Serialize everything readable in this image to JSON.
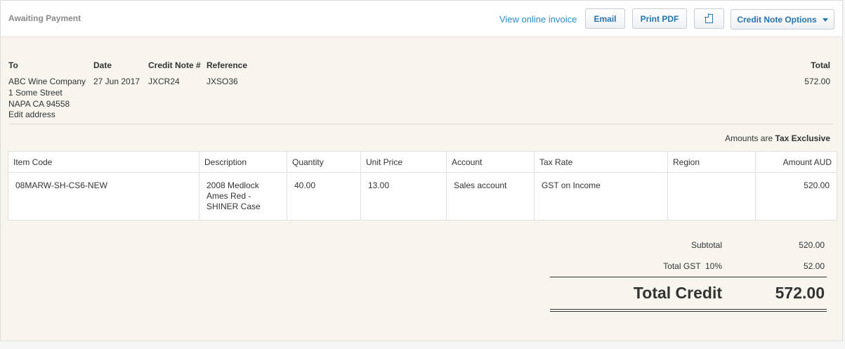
{
  "header": {
    "status": "Awaiting Payment",
    "view_online": "View online invoice",
    "email": "Email",
    "print_pdf": "Print PDF",
    "options": "Credit Note Options"
  },
  "info": {
    "to_label": "To",
    "date_label": "Date",
    "number_label": "Credit Note #",
    "reference_label": "Reference",
    "total_label": "Total",
    "contact": "ABC Wine Company",
    "address_line1": "1 Some Street",
    "address_line2": "NAPA CA 94558",
    "edit_address": "Edit address",
    "date": "27 Jun 2017",
    "number": "JXCR24",
    "reference": "JXSO36",
    "total": "572.00"
  },
  "amounts_are": {
    "prefix": "Amounts are",
    "value": "Tax Exclusive"
  },
  "table": {
    "headers": [
      "Item Code",
      "Description",
      "Quantity",
      "Unit Price",
      "Account",
      "Tax Rate",
      "Region",
      "Amount AUD"
    ],
    "rows": [
      {
        "item_code": "08MARW-SH-CS6-NEW",
        "description": "2008 Medlock Ames Red - SHINER Case",
        "quantity": "40.00",
        "unit_price": "13.00",
        "account": "Sales account",
        "tax_rate": "GST on Income",
        "region": "",
        "amount": "520.00"
      }
    ]
  },
  "totals": {
    "subtotal_label": "Subtotal",
    "subtotal": "520.00",
    "gst_label": "Total GST  10%",
    "gst": "52.00",
    "total_credit_label": "Total Credit",
    "total_credit": "572.00"
  }
}
